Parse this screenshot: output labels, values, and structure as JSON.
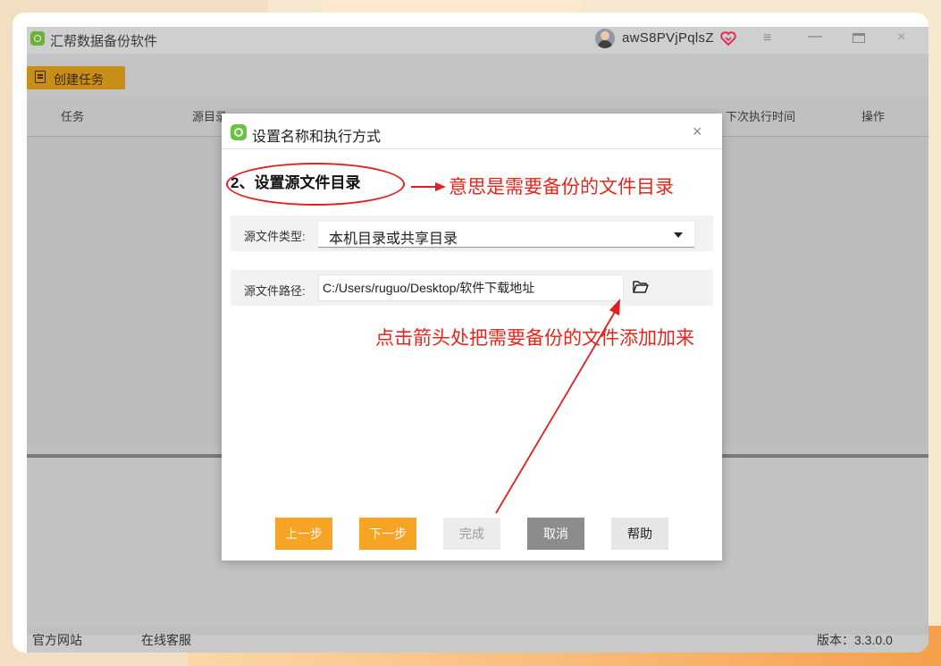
{
  "app": {
    "title": "汇帮数据备份软件",
    "username": "awS8PVjPqlsZ",
    "menu_icon": "≡",
    "minimize_icon": "—",
    "close_icon": "×"
  },
  "toolbar": {
    "create_task_label": "创建任务"
  },
  "table": {
    "headers": [
      "任务",
      "源目录",
      "下次执行时间",
      "操作"
    ]
  },
  "footer": {
    "website_label": "官方网站",
    "support_label": "在线客服",
    "version_label": "版本：3.3.0.0"
  },
  "dialog": {
    "title": "设置名称和执行方式",
    "close_icon": "×",
    "step_heading": "2、设置源文件目录",
    "source_type_label": "源文件类型:",
    "source_type_value": "本机目录或共享目录",
    "source_path_label": "源文件路径:",
    "source_path_value": "C:/Users/ruguo/Desktop/软件下载地址",
    "buttons": {
      "prev": "上一步",
      "next": "下一步",
      "finish": "完成",
      "cancel": "取消",
      "help": "帮助"
    }
  },
  "annotations": {
    "top_note": "意思是需要备份的文件目录",
    "middle_note": "点击箭头处把需要备份的文件添加加来"
  },
  "colors": {
    "accent": "#f7a323",
    "annotation_red": "#e8251c",
    "brand_green": "#6cc04a"
  },
  "icons": [
    "app-logo-icon",
    "avatar-icon",
    "vip-heart-icon",
    "menu-icon",
    "minimize-icon",
    "maximize-icon",
    "close-icon",
    "task-list-icon",
    "folder-open-icon",
    "dropdown-caret-icon"
  ]
}
